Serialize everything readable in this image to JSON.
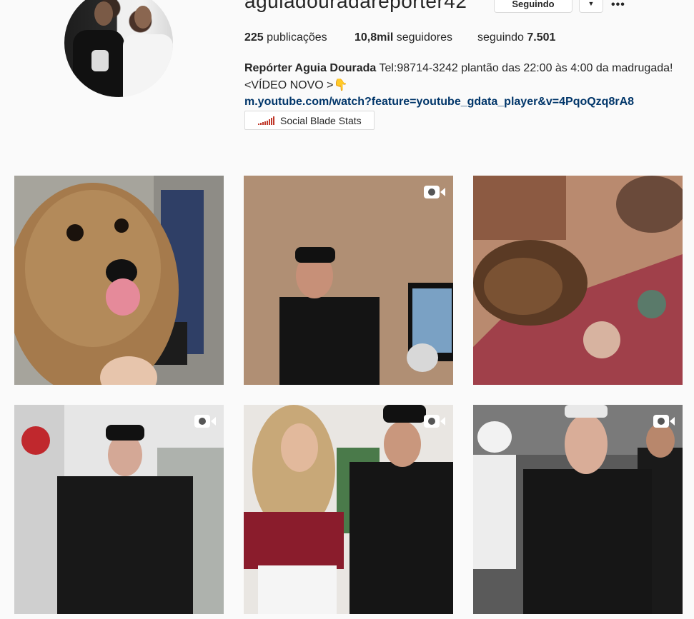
{
  "profile": {
    "username": "aguiadouradareporter42",
    "follow_button": "Seguindo",
    "dropdown_icon": "chevron-down-icon",
    "more_icon": "ellipsis-icon",
    "more_label": "•••",
    "stats": {
      "posts_value": "225",
      "posts_label": "publicações",
      "followers_value": "10,8mil",
      "followers_label": "seguidores",
      "following_label": "seguindo",
      "following_value": "7.501"
    },
    "bio": {
      "name": "Repórter Aguia Dourada",
      "text": "Tel:98714-3242 plantão das 22:00 às 4:00 da madrugada!",
      "line2": "<VÍDEO NOVO >👇",
      "link": "m.youtube.com/watch?feature=youtube_gdata_player&v=4PqoQzq8rA8"
    },
    "social_blade": "Social Blade Stats"
  },
  "grid": {
    "posts": [
      {
        "id": "post-1",
        "is_video": false
      },
      {
        "id": "post-2",
        "is_video": true
      },
      {
        "id": "post-3",
        "is_video": false
      },
      {
        "id": "post-4",
        "is_video": true
      },
      {
        "id": "post-5",
        "is_video": true
      },
      {
        "id": "post-6",
        "is_video": true
      }
    ]
  },
  "colors": {
    "background": "#fafafa",
    "link": "#003569",
    "border": "#dbdbdb",
    "social_bars": "#c0392b"
  }
}
